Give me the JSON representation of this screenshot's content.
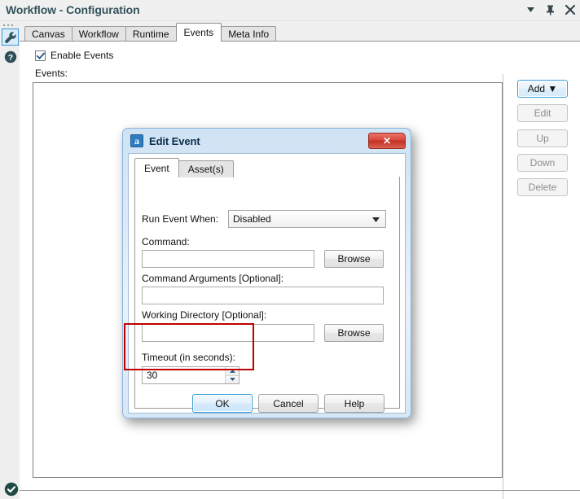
{
  "window": {
    "title": "Workflow - Configuration",
    "controls": [
      {
        "name": "minimize-dropdown",
        "glyph": "caret-down-icon"
      },
      {
        "name": "pin",
        "glyph": "pin-icon"
      },
      {
        "name": "close",
        "glyph": "close-icon"
      }
    ]
  },
  "rail": {
    "items": [
      {
        "name": "wrench",
        "icon": "wrench-icon",
        "selected": true
      },
      {
        "name": "help",
        "icon": "question-circle-icon",
        "selected": false
      },
      {
        "name": "status",
        "icon": "check-circle-icon",
        "selected": false
      }
    ]
  },
  "tabs": {
    "items": [
      {
        "label": "Canvas",
        "active": false
      },
      {
        "label": "Workflow",
        "active": false
      },
      {
        "label": "Runtime",
        "active": false
      },
      {
        "label": "Events",
        "active": true
      },
      {
        "label": "Meta Info",
        "active": false
      }
    ]
  },
  "events_panel": {
    "enable_checkbox_label": "Enable Events",
    "enable_checked": true,
    "events_label": "Events:",
    "list_items": [],
    "buttons": [
      {
        "label": "Add ▼",
        "state": "focused"
      },
      {
        "label": "Edit",
        "state": "disabled"
      },
      {
        "label": "Up",
        "state": "disabled"
      },
      {
        "label": "Down",
        "state": "disabled"
      },
      {
        "label": "Delete",
        "state": "disabled"
      }
    ]
  },
  "dialog": {
    "title": "Edit Event",
    "app_icon_letter": "a",
    "close_label": "✕",
    "tabs": [
      {
        "label": "Event",
        "active": true
      },
      {
        "label": "Asset(s)",
        "active": false
      }
    ],
    "fields": {
      "run_event_when_label": "Run Event When:",
      "run_event_when_value": "Disabled",
      "command_label": "Command:",
      "command_value": "",
      "command_placeholder": "",
      "command_browse_label": "Browse",
      "command_args_label": "Command Arguments [Optional]:",
      "command_args_value": "",
      "command_args_placeholder": "",
      "working_dir_label": "Working Directory [Optional]:",
      "working_dir_value": "",
      "working_dir_placeholder": "",
      "working_dir_browse_label": "Browse",
      "timeout_label": "Timeout (in seconds):",
      "timeout_value": "30"
    },
    "buttons": {
      "ok": "OK",
      "cancel": "Cancel",
      "help": "Help"
    }
  },
  "annotation": {
    "color": "#c00000",
    "target": "timeout-field-group"
  }
}
